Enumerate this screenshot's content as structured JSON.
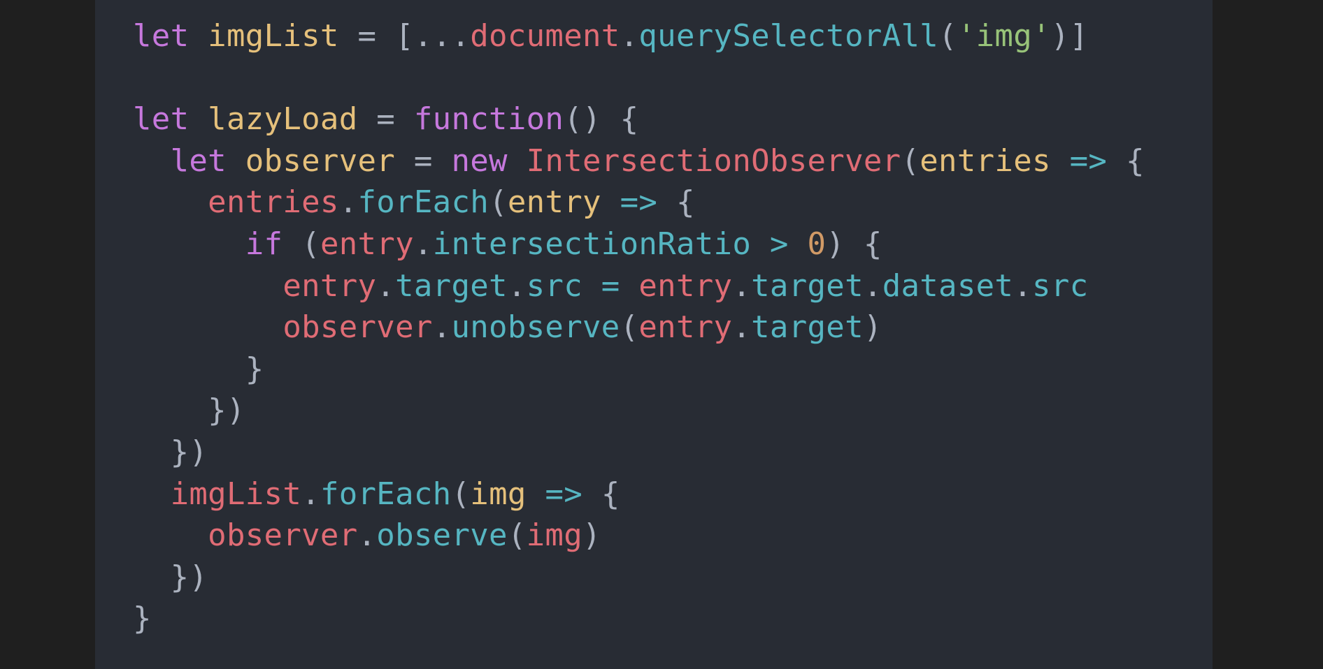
{
  "colors": {
    "background": "#1f1f1f",
    "editor_background": "#282c34",
    "keyword": "#c678dd",
    "declaration": "#e5c07b",
    "variable": "#e06c75",
    "function": "#56b6c2",
    "string": "#98c379",
    "number": "#d19a66",
    "punctuation": "#abb2bf"
  },
  "code": {
    "lines": [
      [
        {
          "t": "let",
          "k": "kw"
        },
        {
          "t": " ",
          "k": "pu"
        },
        {
          "t": "imgList",
          "k": "vd"
        },
        {
          "t": " = [...",
          "k": "pu"
        },
        {
          "t": "document",
          "k": "va"
        },
        {
          "t": ".",
          "k": "pu"
        },
        {
          "t": "querySelectorAll",
          "k": "fn"
        },
        {
          "t": "(",
          "k": "pu"
        },
        {
          "t": "'img'",
          "k": "st"
        },
        {
          "t": ")]",
          "k": "pu"
        }
      ],
      [],
      [
        {
          "t": "let",
          "k": "kw"
        },
        {
          "t": " ",
          "k": "pu"
        },
        {
          "t": "lazyLoad",
          "k": "vd"
        },
        {
          "t": " = ",
          "k": "pu"
        },
        {
          "t": "function",
          "k": "kw"
        },
        {
          "t": "() {",
          "k": "pu"
        }
      ],
      [
        {
          "t": "  ",
          "k": "pu"
        },
        {
          "t": "let",
          "k": "kw"
        },
        {
          "t": " ",
          "k": "pu"
        },
        {
          "t": "observer",
          "k": "vd"
        },
        {
          "t": " = ",
          "k": "pu"
        },
        {
          "t": "new",
          "k": "kw"
        },
        {
          "t": " ",
          "k": "pu"
        },
        {
          "t": "IntersectionObserver",
          "k": "va"
        },
        {
          "t": "(",
          "k": "pu"
        },
        {
          "t": "entries",
          "k": "vd"
        },
        {
          "t": " ",
          "k": "pu"
        },
        {
          "t": "=>",
          "k": "fn"
        },
        {
          "t": " {",
          "k": "pu"
        }
      ],
      [
        {
          "t": "    ",
          "k": "pu"
        },
        {
          "t": "entries",
          "k": "va"
        },
        {
          "t": ".",
          "k": "pu"
        },
        {
          "t": "forEach",
          "k": "fn"
        },
        {
          "t": "(",
          "k": "pu"
        },
        {
          "t": "entry",
          "k": "vd"
        },
        {
          "t": " ",
          "k": "pu"
        },
        {
          "t": "=>",
          "k": "fn"
        },
        {
          "t": " {",
          "k": "pu"
        }
      ],
      [
        {
          "t": "      ",
          "k": "pu"
        },
        {
          "t": "if",
          "k": "kw"
        },
        {
          "t": " (",
          "k": "pu"
        },
        {
          "t": "entry",
          "k": "va"
        },
        {
          "t": ".",
          "k": "pu"
        },
        {
          "t": "intersectionRatio",
          "k": "fn"
        },
        {
          "t": " ",
          "k": "pu"
        },
        {
          "t": ">",
          "k": "fn"
        },
        {
          "t": " ",
          "k": "pu"
        },
        {
          "t": "0",
          "k": "nm"
        },
        {
          "t": ") {",
          "k": "pu"
        }
      ],
      [
        {
          "t": "        ",
          "k": "pu"
        },
        {
          "t": "entry",
          "k": "va"
        },
        {
          "t": ".",
          "k": "pu"
        },
        {
          "t": "target",
          "k": "fn"
        },
        {
          "t": ".",
          "k": "pu"
        },
        {
          "t": "src",
          "k": "fn"
        },
        {
          "t": " ",
          "k": "pu"
        },
        {
          "t": "=",
          "k": "fn"
        },
        {
          "t": " ",
          "k": "pu"
        },
        {
          "t": "entry",
          "k": "va"
        },
        {
          "t": ".",
          "k": "pu"
        },
        {
          "t": "target",
          "k": "fn"
        },
        {
          "t": ".",
          "k": "pu"
        },
        {
          "t": "dataset",
          "k": "fn"
        },
        {
          "t": ".",
          "k": "pu"
        },
        {
          "t": "src",
          "k": "fn"
        }
      ],
      [
        {
          "t": "        ",
          "k": "pu"
        },
        {
          "t": "observer",
          "k": "va"
        },
        {
          "t": ".",
          "k": "pu"
        },
        {
          "t": "unobserve",
          "k": "fn"
        },
        {
          "t": "(",
          "k": "pu"
        },
        {
          "t": "entry",
          "k": "va"
        },
        {
          "t": ".",
          "k": "pu"
        },
        {
          "t": "target",
          "k": "fn"
        },
        {
          "t": ")",
          "k": "pu"
        }
      ],
      [
        {
          "t": "      }",
          "k": "pu"
        }
      ],
      [
        {
          "t": "    })",
          "k": "pu"
        }
      ],
      [
        {
          "t": "  })",
          "k": "pu"
        }
      ],
      [
        {
          "t": "  ",
          "k": "pu"
        },
        {
          "t": "imgList",
          "k": "va"
        },
        {
          "t": ".",
          "k": "pu"
        },
        {
          "t": "forEach",
          "k": "fn"
        },
        {
          "t": "(",
          "k": "pu"
        },
        {
          "t": "img",
          "k": "vd"
        },
        {
          "t": " ",
          "k": "pu"
        },
        {
          "t": "=>",
          "k": "fn"
        },
        {
          "t": " {",
          "k": "pu"
        }
      ],
      [
        {
          "t": "    ",
          "k": "pu"
        },
        {
          "t": "observer",
          "k": "va"
        },
        {
          "t": ".",
          "k": "pu"
        },
        {
          "t": "observe",
          "k": "fn"
        },
        {
          "t": "(",
          "k": "pu"
        },
        {
          "t": "img",
          "k": "va"
        },
        {
          "t": ")",
          "k": "pu"
        }
      ],
      [
        {
          "t": "  })",
          "k": "pu"
        }
      ],
      [
        {
          "t": "}",
          "k": "pu"
        }
      ]
    ]
  }
}
